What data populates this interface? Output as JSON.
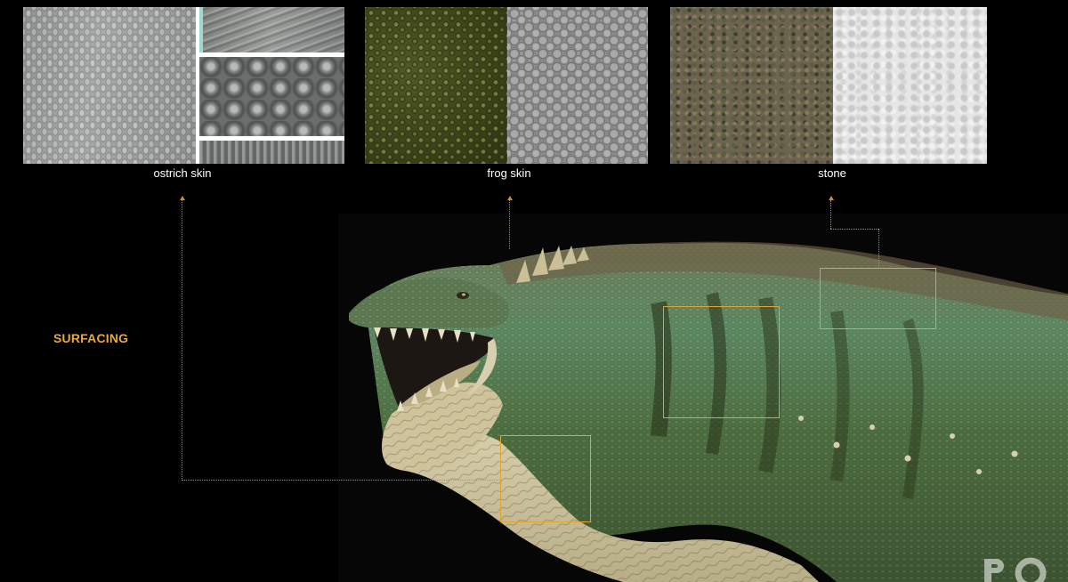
{
  "references": {
    "ostrich": {
      "caption": "ostrich skin"
    },
    "frog": {
      "caption": "frog skin"
    },
    "stone": {
      "caption": "stone"
    }
  },
  "section_label": "SURFACING",
  "colors": {
    "accent": "#e7a93c",
    "highlight_box": "#e2a32e",
    "connector": "#c98a3a",
    "background": "#000000"
  },
  "creature": {
    "description_icon": "creature-render"
  },
  "watermark": "watermark-logo"
}
